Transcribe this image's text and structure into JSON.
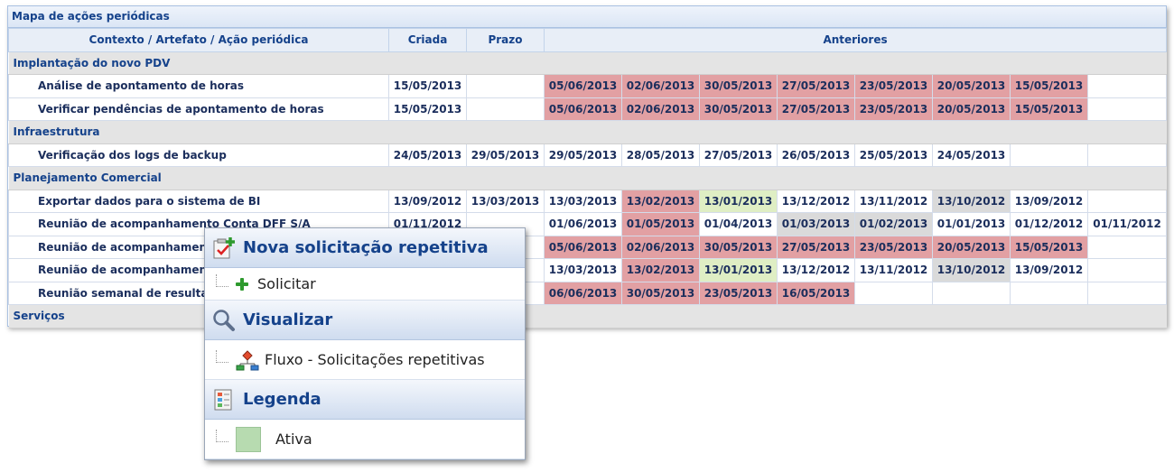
{
  "panel": {
    "title": "Mapa de ações periódicas"
  },
  "table": {
    "headers": [
      "Contexto / Artefato / Ação periódica",
      "Criada",
      "Prazo",
      "Anteriores"
    ],
    "groups": [
      {
        "name": "Implantação do novo PDV",
        "rows": [
          {
            "name": "Análise de apontamento de horas",
            "criada": "15/05/2013",
            "prazo": "",
            "prev": [
              {
                "d": "05/06/2013",
                "c": "red"
              },
              {
                "d": "02/06/2013",
                "c": "red"
              },
              {
                "d": "30/05/2013",
                "c": "red"
              },
              {
                "d": "27/05/2013",
                "c": "red"
              },
              {
                "d": "23/05/2013",
                "c": "red"
              },
              {
                "d": "20/05/2013",
                "c": "red"
              },
              {
                "d": "15/05/2013",
                "c": "red"
              },
              {
                "d": "",
                "c": ""
              }
            ]
          },
          {
            "name": "Verificar pendências de apontamento de horas",
            "criada": "15/05/2013",
            "prazo": "",
            "prev": [
              {
                "d": "05/06/2013",
                "c": "red"
              },
              {
                "d": "02/06/2013",
                "c": "red"
              },
              {
                "d": "30/05/2013",
                "c": "red"
              },
              {
                "d": "27/05/2013",
                "c": "red"
              },
              {
                "d": "23/05/2013",
                "c": "red"
              },
              {
                "d": "20/05/2013",
                "c": "red"
              },
              {
                "d": "15/05/2013",
                "c": "red"
              },
              {
                "d": "",
                "c": ""
              }
            ]
          }
        ]
      },
      {
        "name": "Infraestrutura",
        "rows": [
          {
            "name": "Verificação dos logs de backup",
            "criada": "24/05/2013",
            "prazo": "29/05/2013",
            "prev": [
              {
                "d": "29/05/2013",
                "c": ""
              },
              {
                "d": "28/05/2013",
                "c": ""
              },
              {
                "d": "27/05/2013",
                "c": ""
              },
              {
                "d": "26/05/2013",
                "c": ""
              },
              {
                "d": "25/05/2013",
                "c": ""
              },
              {
                "d": "24/05/2013",
                "c": ""
              },
              {
                "d": "",
                "c": ""
              },
              {
                "d": "",
                "c": ""
              }
            ]
          }
        ]
      },
      {
        "name": "Planejamento Comercial",
        "rows": [
          {
            "name": "Exportar dados para o sistema de BI",
            "criada": "13/09/2012",
            "prazo": "13/03/2013",
            "prev": [
              {
                "d": "13/03/2013",
                "c": ""
              },
              {
                "d": "13/02/2013",
                "c": "red"
              },
              {
                "d": "13/01/2013",
                "c": "green"
              },
              {
                "d": "13/12/2012",
                "c": ""
              },
              {
                "d": "13/11/2012",
                "c": ""
              },
              {
                "d": "13/10/2012",
                "c": "gray"
              },
              {
                "d": "13/09/2012",
                "c": ""
              },
              {
                "d": "",
                "c": ""
              }
            ]
          },
          {
            "name": "Reunião de acompanhamento Conta DFF S/A",
            "criada": "01/11/2012",
            "prazo": "",
            "prev": [
              {
                "d": "01/06/2013",
                "c": ""
              },
              {
                "d": "01/05/2013",
                "c": "red"
              },
              {
                "d": "01/04/2013",
                "c": ""
              },
              {
                "d": "01/03/2013",
                "c": "gray"
              },
              {
                "d": "01/02/2013",
                "c": "gray"
              },
              {
                "d": "01/01/2013",
                "c": ""
              },
              {
                "d": "01/12/2012",
                "c": ""
              },
              {
                "d": "01/11/2012",
                "c": ""
              }
            ]
          },
          {
            "name": "Reunião de acompanhamento C",
            "criada": "",
            "prazo": "",
            "prev": [
              {
                "d": "05/06/2013",
                "c": "red"
              },
              {
                "d": "02/06/2013",
                "c": "red"
              },
              {
                "d": "30/05/2013",
                "c": "red"
              },
              {
                "d": "27/05/2013",
                "c": "red"
              },
              {
                "d": "23/05/2013",
                "c": "red"
              },
              {
                "d": "20/05/2013",
                "c": "red"
              },
              {
                "d": "15/05/2013",
                "c": "red"
              },
              {
                "d": "",
                "c": ""
              }
            ]
          },
          {
            "name": "Reunião de acompanhamento C",
            "criada": "",
            "prazo": "13",
            "prev": [
              {
                "d": "13/03/2013",
                "c": ""
              },
              {
                "d": "13/02/2013",
                "c": "red"
              },
              {
                "d": "13/01/2013",
                "c": "green"
              },
              {
                "d": "13/12/2012",
                "c": ""
              },
              {
                "d": "13/11/2012",
                "c": ""
              },
              {
                "d": "13/10/2012",
                "c": "gray"
              },
              {
                "d": "13/09/2012",
                "c": ""
              },
              {
                "d": "",
                "c": ""
              }
            ]
          },
          {
            "name": "Reunião semanal de resultados",
            "criada": "",
            "prazo": "",
            "prev": [
              {
                "d": "06/06/2013",
                "c": "red"
              },
              {
                "d": "30/05/2013",
                "c": "red"
              },
              {
                "d": "23/05/2013",
                "c": "red"
              },
              {
                "d": "16/05/2013",
                "c": "red"
              },
              {
                "d": "",
                "c": ""
              },
              {
                "d": "",
                "c": ""
              },
              {
                "d": "",
                "c": ""
              },
              {
                "d": "",
                "c": ""
              }
            ]
          }
        ]
      },
      {
        "name": "Serviços",
        "rows": []
      }
    ]
  },
  "colors": {
    "red": "#e2a0a3",
    "green": "#dfeec4",
    "gray": "#dadada",
    "header": "#15428b"
  },
  "menu": {
    "sections": [
      {
        "title": "Nova solicitação repetitiva",
        "icon": "checklist-add-icon",
        "items": [
          {
            "label": "Solicitar",
            "icon": "plus-icon"
          }
        ]
      },
      {
        "title": "Visualizar",
        "icon": "magnifier-icon",
        "items": [
          {
            "label": "Fluxo - Solicitações repetitivas",
            "icon": "flowchart-icon"
          }
        ]
      },
      {
        "title": "Legenda",
        "icon": "legend-list-icon",
        "items": [
          {
            "label": "Ativa",
            "icon": "green-swatch-icon"
          }
        ]
      }
    ]
  }
}
